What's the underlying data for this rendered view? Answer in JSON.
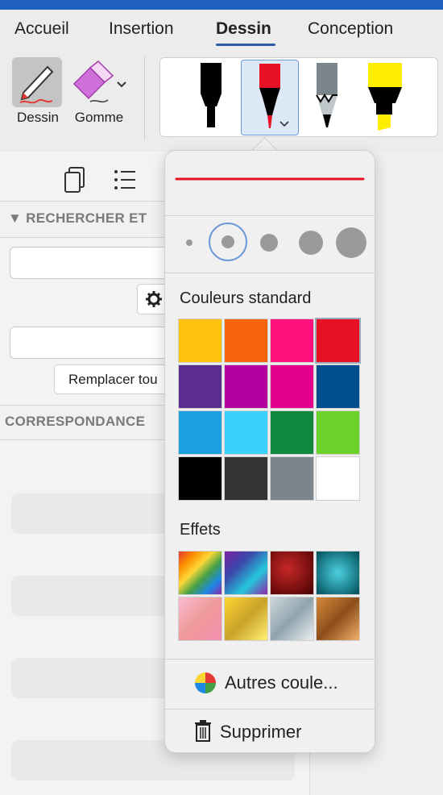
{
  "tabs": [
    "Accueil",
    "Insertion",
    "Dessin",
    "Conception"
  ],
  "ribbon": {
    "draw_label": "Dessin",
    "eraser_label": "Gomme"
  },
  "pane": {
    "section_header": "▼ RECHERCHER ET",
    "replace_all_label": "Remplacer tou",
    "matches_header": "CORRESPONDANCE"
  },
  "pen_popup": {
    "selected_thickness_index": 1,
    "standard_colors_title": "Couleurs standard",
    "standard_colors": [
      "#FFC20E",
      "#F7630C",
      "#FF0F7B",
      "#E81123",
      "#5C2D91",
      "#B4009E",
      "#E3008C",
      "#004E8C",
      "#1BA1E2",
      "#3BD1FF",
      "#10893E",
      "#6BD12B",
      "#000000",
      "#333333",
      "#7A868C",
      "#FFFFFF"
    ],
    "selected_color": "#E81123",
    "effects_title": "Effets",
    "effects": [
      "rainbow",
      "galaxy",
      "lava",
      "ocean",
      "rose-gold",
      "gold",
      "silver",
      "bronze"
    ],
    "more_colors_label": "Autres coule...",
    "delete_label": "Supprimer"
  },
  "colors": {
    "accent": "#2A5AA8",
    "topbar": "#1F5FBF"
  }
}
